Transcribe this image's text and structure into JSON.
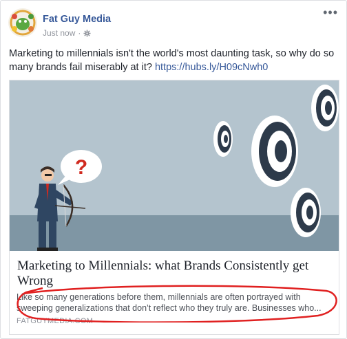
{
  "post": {
    "page_name": "Fat Guy Media",
    "timestamp": "Just now",
    "privacy_icon": "globe-gear-icon",
    "more_icon": "ellipsis-icon",
    "text": "Marketing to millennials isn't the world's most daunting task, so why do so many brands fail miserably at it? ",
    "link_text": "https://hubs.ly/H09cNwh0"
  },
  "link_preview": {
    "title": "Marketing to Millennials: what Brands Consistently get Wrong",
    "description_line1": "Like so many generations before them, millennials are often portrayed with",
    "description_line2": "sweeping generalizations that don’t reflect who they truly are. Businesses who...",
    "domain": "FATGUYMEDIA.COM",
    "speech_bubble_text": "?"
  },
  "colors": {
    "brand_blue": "#365899",
    "annotation_red": "#e02020",
    "sky": "#b3c3cd",
    "ground": "#7f96a4"
  }
}
